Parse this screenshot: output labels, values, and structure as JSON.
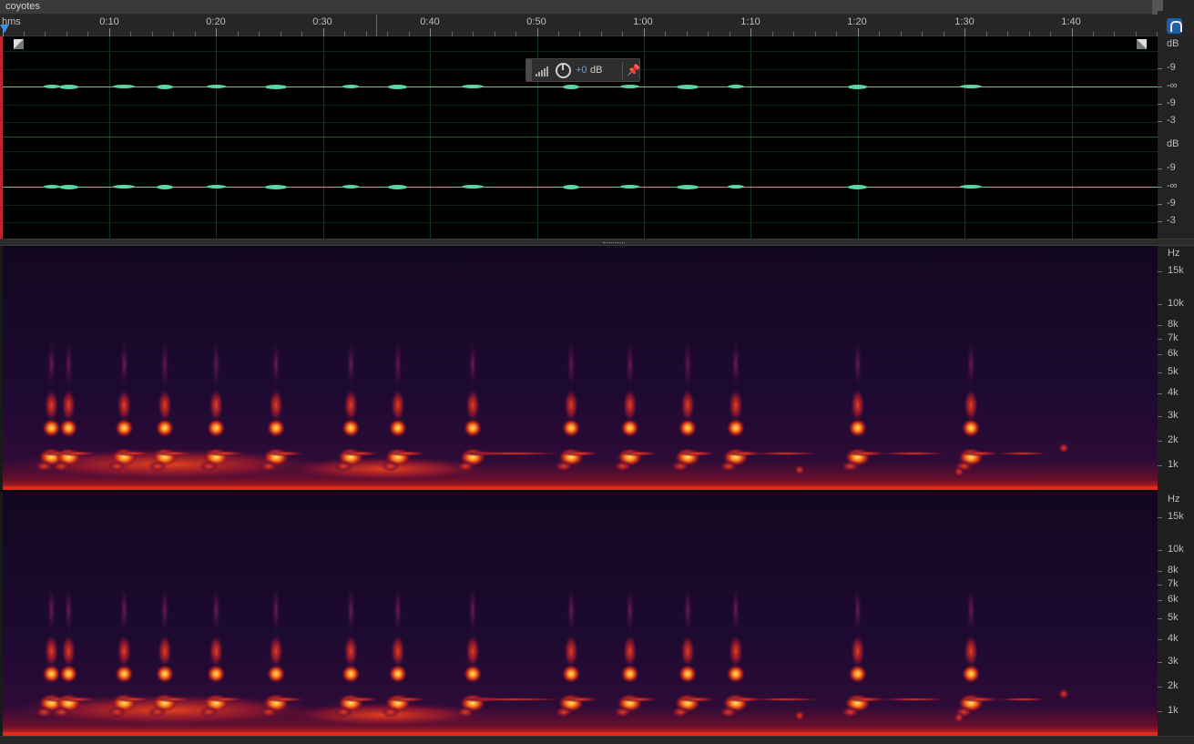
{
  "window": {
    "clip_title": "coyotes"
  },
  "ruler": {
    "unit": "hms",
    "labels": [
      "0:10",
      "0:20",
      "0:30",
      "0:40",
      "0:50",
      "1:00",
      "1:10",
      "1:20",
      "1:30",
      "1:40"
    ]
  },
  "hud": {
    "gain_value": "+0",
    "gain_unit": "dB"
  },
  "waveform": {
    "channel_top_db_labels": [
      "dB",
      "-9",
      "-∞",
      "-9",
      "-3"
    ],
    "channel_bottom_db_labels": [
      "dB",
      "-9",
      "-∞",
      "-9",
      "-3"
    ],
    "color": "#5ad8a4"
  },
  "spectral": {
    "hz_labels": [
      "Hz",
      "15k",
      "10k",
      "8k",
      "7k",
      "6k",
      "5k",
      "4k",
      "3k",
      "2k",
      "1k"
    ],
    "colors": {
      "background": "#17082a",
      "low": "#5a0f3a",
      "mid": "#c0201a",
      "high": "#ff8a1e",
      "peak": "#ffe27a"
    }
  },
  "icons": {
    "snap": "magnet-icon",
    "hud_meter": "signal-bars-icon",
    "hud_knob": "gain-knob-icon",
    "hud_pin": "pin-icon",
    "fade_in": "fade-in-handle-icon",
    "fade_out": "fade-out-handle-icon"
  }
}
